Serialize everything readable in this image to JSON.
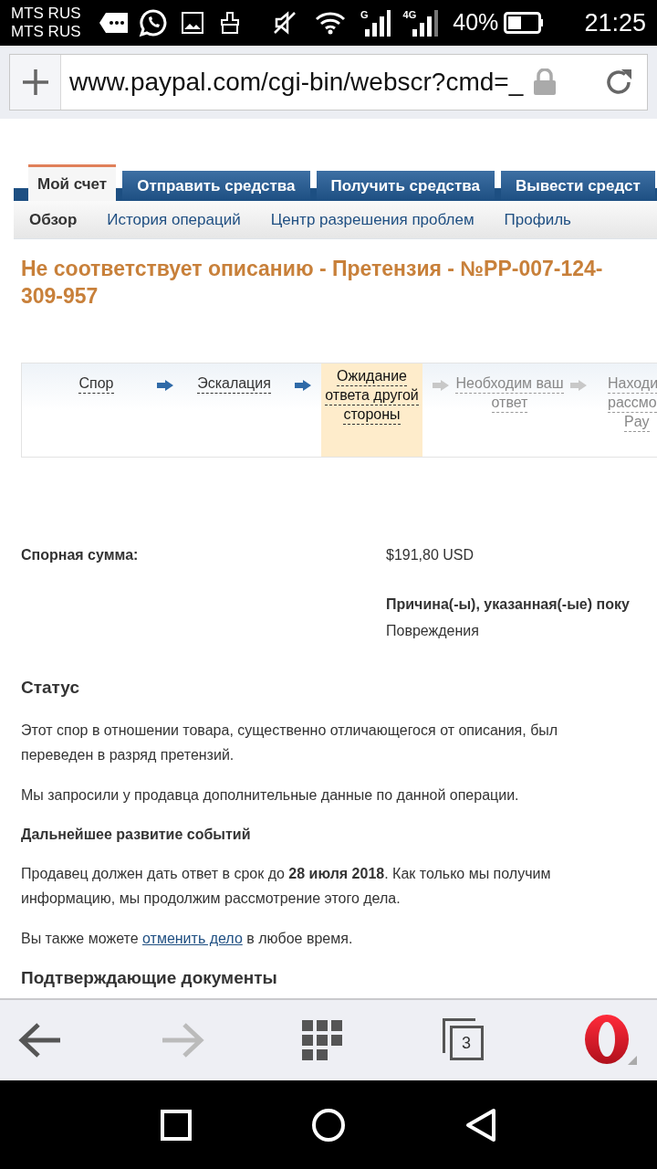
{
  "status_bar": {
    "carriers": [
      "MTS RUS",
      "MTS RUS"
    ],
    "network_labels": [
      "G",
      "4G"
    ],
    "battery_text": "40%",
    "time": "21:25"
  },
  "address_bar": {
    "url": "www.paypal.com/cgi-bin/webscr?cmd=_"
  },
  "tabs": [
    {
      "label": "Мой счет",
      "selected": true
    },
    {
      "label": "Отправить средства",
      "selected": false
    },
    {
      "label": "Получить средства",
      "selected": false
    },
    {
      "label": "Вывести средст",
      "selected": false
    }
  ],
  "subnav": [
    {
      "label": "Обзор",
      "selected": true
    },
    {
      "label": "История операций",
      "selected": false
    },
    {
      "label": "Центр разрешения проблем",
      "selected": false
    },
    {
      "label": "Профиль",
      "selected": false
    }
  ],
  "title": "Не соответствует описанию - Претензия - №PP-007-124-309-957",
  "steps": [
    {
      "lines": [
        "Спор"
      ],
      "done": true,
      "current": false
    },
    {
      "lines": [
        "Эскалация"
      ],
      "done": true,
      "current": false
    },
    {
      "lines": [
        "Ожидание",
        "ответа другой",
        "стороны"
      ],
      "done": false,
      "current": true
    },
    {
      "lines": [
        "Необходим ваш",
        "ответ"
      ],
      "done": false,
      "current": false
    },
    {
      "lines": [
        "Находи",
        "рассмо",
        "Pay"
      ],
      "done": false,
      "current": false
    }
  ],
  "amount": {
    "label": "Спорная сумма:",
    "value": "$191,80 USD"
  },
  "reason": {
    "label": "Причина(-ы), указанная(-ые) поку",
    "value": "Повреждения"
  },
  "status": {
    "heading": "Статус",
    "paragraphs": [
      "Этот спор в отношении товара, существенно отличающегося от описания, был переведен в разряд претензий.",
      "Мы запросили у продавца дополнительные данные по данной операции."
    ]
  },
  "next": {
    "heading": "Дальнейшее развитие событий",
    "paragraph": "Продавец должен дать ответ в срок до **28 июля 2018**. Как только мы получим информацию, мы продолжим рассмотрение этого дела.",
    "cancel": {
      "before": "Вы также можете",
      "link": "отменить дело",
      "after": "в любое время."
    }
  },
  "documents_heading": "Подтверждающие документы",
  "bottom_bar": {
    "tab_count": "3"
  }
}
